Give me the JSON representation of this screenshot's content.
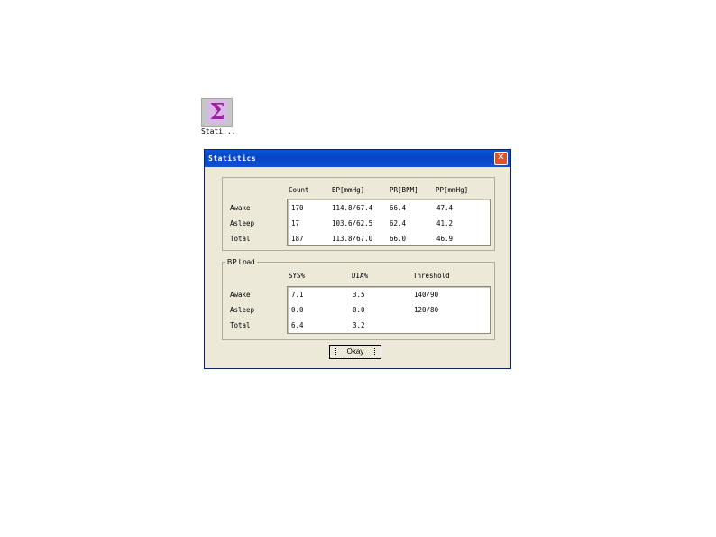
{
  "launcher": {
    "icon": "sigma-icon",
    "glyph": "Σ",
    "label": "Stati..."
  },
  "window": {
    "title": "Statistics",
    "close_glyph": "✕"
  },
  "summary": {
    "headers": [
      "Count",
      "BP[mmHg]",
      "PR[BPM]",
      "PP[mmHg]"
    ],
    "rows": [
      {
        "label": "Awake",
        "values": [
          "170",
          "114.8/67.4",
          "66.4",
          "47.4"
        ]
      },
      {
        "label": "Asleep",
        "values": [
          "17",
          "103.6/62.5",
          "62.4",
          "41.2"
        ]
      },
      {
        "label": "Total",
        "values": [
          "187",
          "113.8/67.0",
          "66.0",
          "46.9"
        ]
      }
    ]
  },
  "bp_load": {
    "legend": "BP Load",
    "headers": [
      "SYS%",
      "DIA%",
      "Threshold"
    ],
    "rows": [
      {
        "label": "Awake",
        "values": [
          "7.1",
          "3.5",
          "140/90"
        ]
      },
      {
        "label": "Asleep",
        "values": [
          "0.0",
          "0.0",
          "120/80"
        ]
      },
      {
        "label": "Total",
        "values": [
          "6.4",
          "3.2",
          ""
        ]
      }
    ]
  },
  "ok_button": {
    "label": "Okay"
  }
}
